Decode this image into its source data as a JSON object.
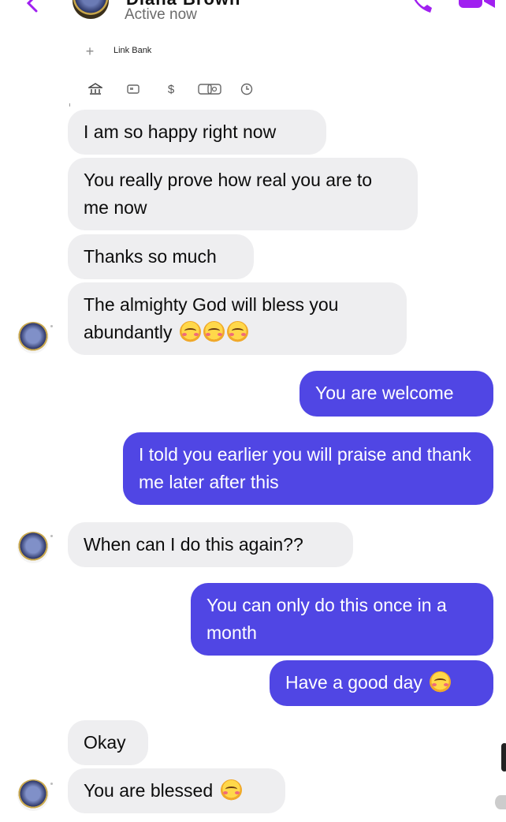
{
  "header": {
    "name_partial": "Diana Brown",
    "status": "Active now"
  },
  "toolbar": {
    "plus": "+",
    "link_bank": "Link Bank",
    "dollar": "$"
  },
  "messages": [
    {
      "id": "m1",
      "side": "in",
      "text": "I am so happy right now"
    },
    {
      "id": "m2",
      "side": "in",
      "text": "You really prove how real you are to me now"
    },
    {
      "id": "m3",
      "side": "in",
      "text": "Thanks so much"
    },
    {
      "id": "m4",
      "side": "in",
      "text": "The almighty God will bless you abundantly",
      "emoji": [
        "smiling-face-with-hearts",
        "smiling-face-with-hearts",
        "smiling-face-with-hearts"
      ]
    },
    {
      "id": "m5",
      "side": "out",
      "text": "You are welcome"
    },
    {
      "id": "m6",
      "side": "out",
      "text": "I told you earlier you will praise and thank me later after this"
    },
    {
      "id": "m7",
      "side": "in",
      "text": "When can I do this again??"
    },
    {
      "id": "m8",
      "side": "out",
      "text": "You can only do this once in a month"
    },
    {
      "id": "m9",
      "side": "out",
      "text": "Have a good day",
      "emoji": [
        "smiling-face-with-hearts"
      ]
    },
    {
      "id": "m10",
      "side": "in",
      "text": "Okay"
    },
    {
      "id": "m11",
      "side": "in",
      "text": "You are blessed",
      "emoji": [
        "face-blowing-a-kiss"
      ]
    }
  ],
  "colors": {
    "accent": "#5046e4",
    "incoming_bubble": "#eeeef0",
    "header_icons": "#a020f0"
  }
}
